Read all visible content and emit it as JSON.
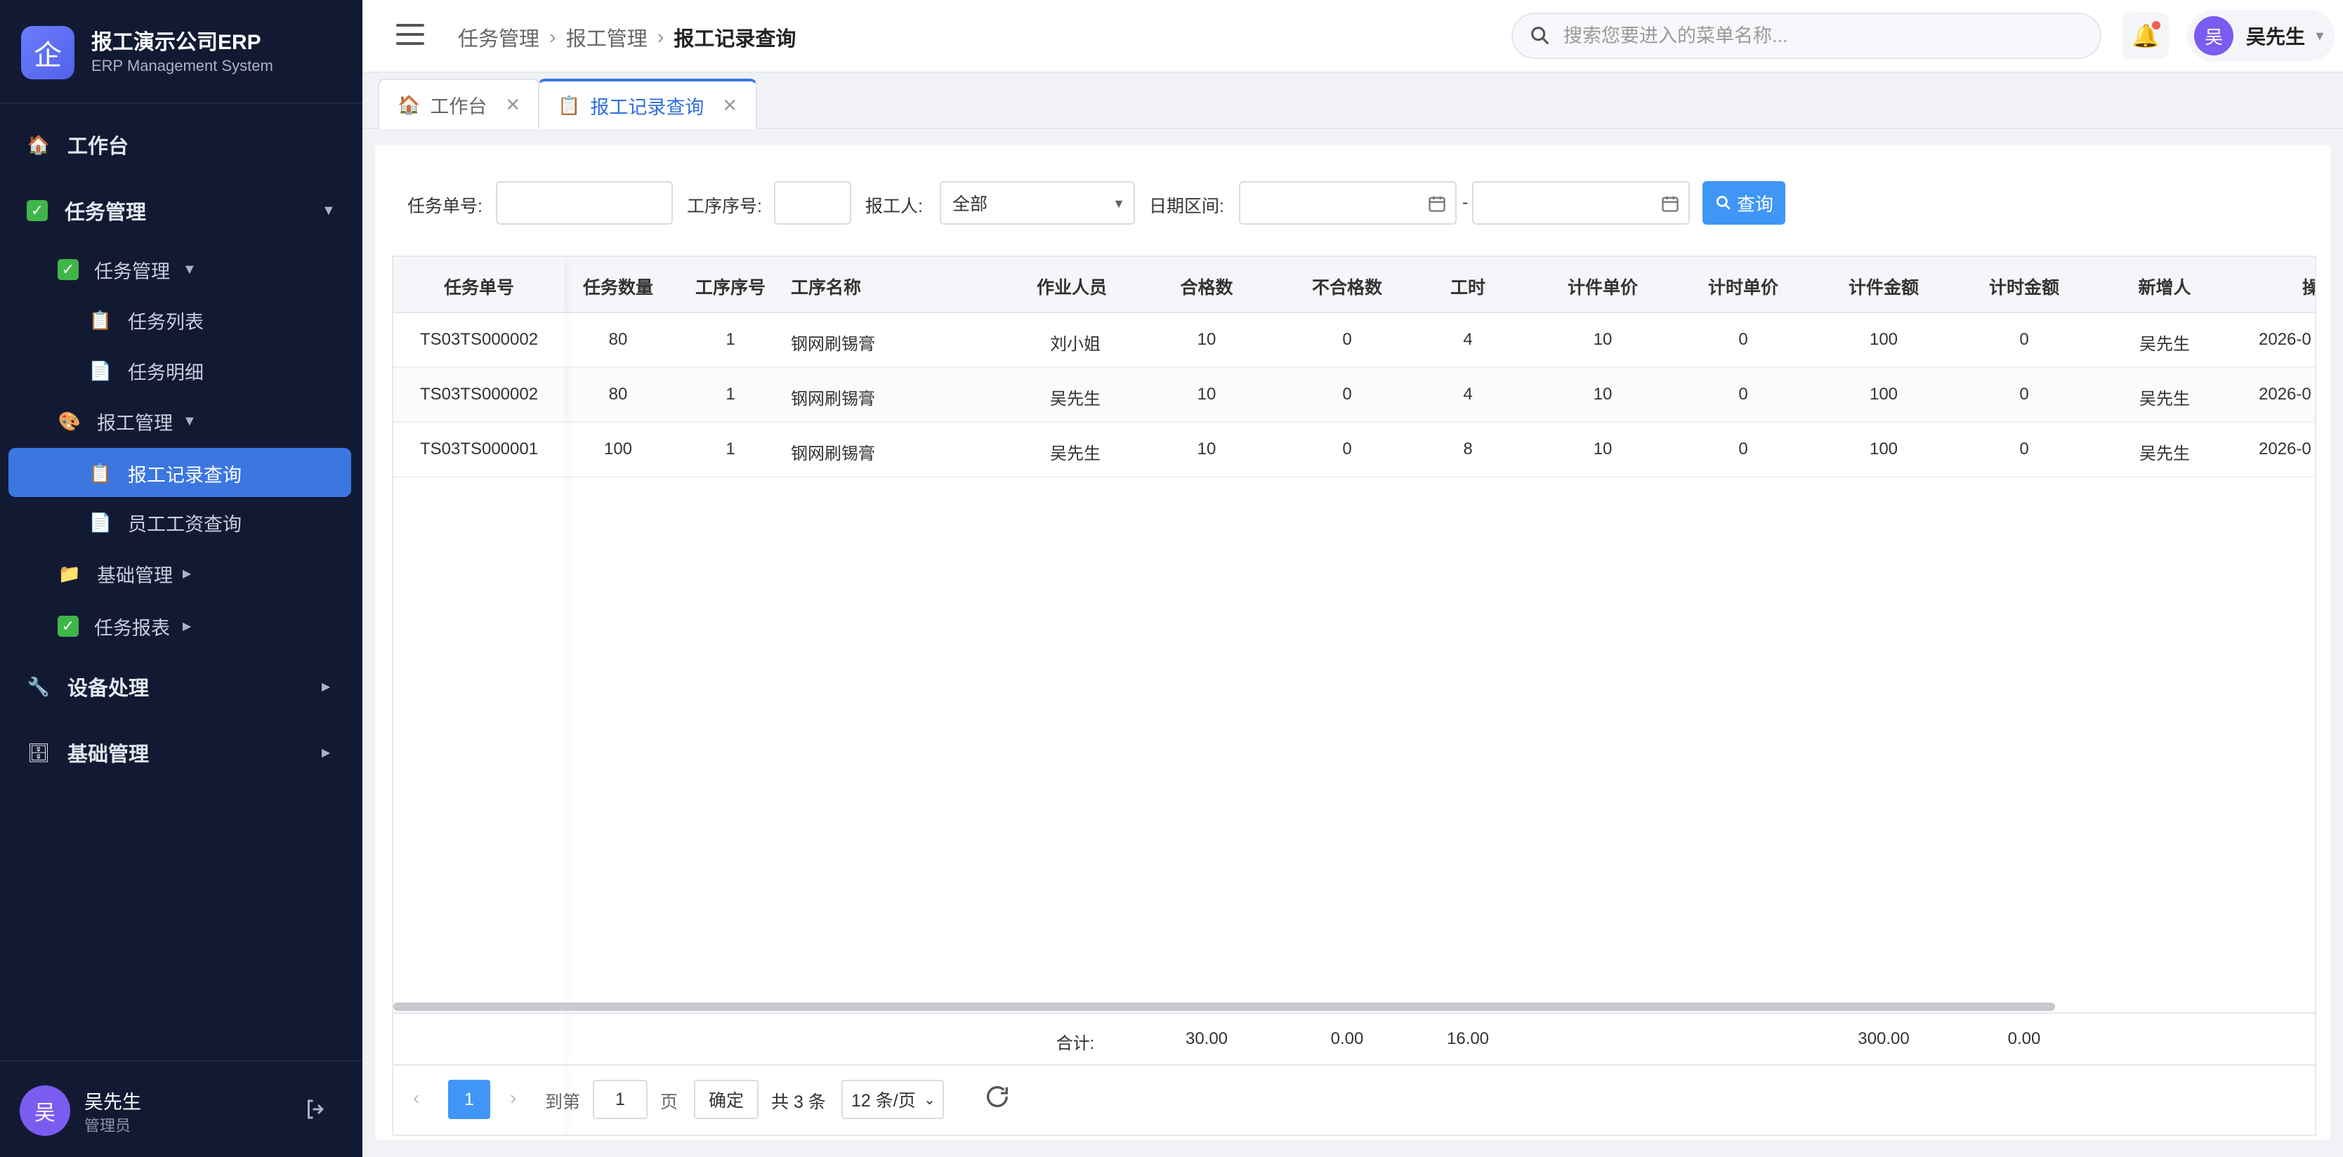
{
  "brand": {
    "logo_char": "企",
    "name": "报工演示公司ERP",
    "subtitle": "ERP Management System"
  },
  "sidebar": {
    "items": [
      {
        "label": "工作台",
        "icon": "house-icon"
      },
      {
        "label": "任务管理",
        "icon": "checkbox-icon",
        "caret": "▼"
      },
      {
        "label": "任务管理",
        "icon": "checkbox-icon",
        "caret": "▼"
      },
      {
        "label": "任务列表",
        "icon": "clipboard-icon"
      },
      {
        "label": "任务明细",
        "icon": "document-icon"
      },
      {
        "label": "报工管理",
        "icon": "palette-icon",
        "caret": "▼"
      },
      {
        "label": "报工记录查询",
        "icon": "clipboard-icon",
        "active": true
      },
      {
        "label": "员工工资查询",
        "icon": "document-icon"
      },
      {
        "label": "基础管理",
        "icon": "folder-icon",
        "caret": "▶"
      },
      {
        "label": "任务报表",
        "icon": "checkbox-icon",
        "caret": "▶"
      },
      {
        "label": "设备处理",
        "icon": "wrench-icon",
        "caret": "▶"
      },
      {
        "label": "基础管理",
        "icon": "cabinet-icon",
        "caret": "▶"
      }
    ],
    "user": {
      "avatar": "吴",
      "name": "吴先生",
      "role": "管理员"
    }
  },
  "header": {
    "breadcrumb": [
      "任务管理",
      "报工管理",
      "报工记录查询"
    ],
    "search_placeholder": "搜索您要进入的菜单名称...",
    "user": {
      "avatar": "吴",
      "name": "吴先生"
    }
  },
  "tabs": [
    {
      "label": "工作台",
      "icon": "house-icon"
    },
    {
      "label": "报工记录查询",
      "icon": "clipboard-icon",
      "active": true
    }
  ],
  "filters": {
    "task_no_label": "任务单号:",
    "task_no_value": "",
    "proc_seq_label": "工序序号:",
    "proc_seq_value": "",
    "reporter_label": "报工人:",
    "reporter_value": "全部",
    "date_label": "日期区间:",
    "date_from": "",
    "date_to": "",
    "date_sep": "-",
    "query_button": "查询"
  },
  "table": {
    "columns": [
      "任务单号",
      "任务数量",
      "工序序号",
      "工序名称",
      "作业人员",
      "合格数",
      "不合格数",
      "工时",
      "计件单价",
      "计时单价",
      "计件金额",
      "计时金额",
      "新增人",
      "操"
    ],
    "rows": [
      [
        "TS03TS000002",
        "80",
        "1",
        "钢网刷锡膏",
        "刘小姐",
        "10",
        "0",
        "4",
        "10",
        "0",
        "100",
        "0",
        "吴先生",
        "2026-0"
      ],
      [
        "TS03TS000002",
        "80",
        "1",
        "钢网刷锡膏",
        "吴先生",
        "10",
        "0",
        "4",
        "10",
        "0",
        "100",
        "0",
        "吴先生",
        "2026-0"
      ],
      [
        "TS03TS000001",
        "100",
        "1",
        "钢网刷锡膏",
        "吴先生",
        "10",
        "0",
        "8",
        "10",
        "0",
        "100",
        "0",
        "吴先生",
        "2026-0"
      ]
    ],
    "summary": {
      "label": "合计:",
      "qualified": "30.00",
      "unqualified": "0.00",
      "hours": "16.00",
      "piece_amount": "300.00",
      "time_amount": "0.00"
    }
  },
  "pagination": {
    "current_page": "1",
    "goto_label": "到第",
    "goto_value": "1",
    "page_unit": "页",
    "confirm": "确定",
    "total": "共 3 条",
    "page_size": "12 条/页"
  },
  "colors": {
    "sidebar_bg": "#121a33",
    "accent": "#3b76e1",
    "primary_button": "#4096f7"
  }
}
